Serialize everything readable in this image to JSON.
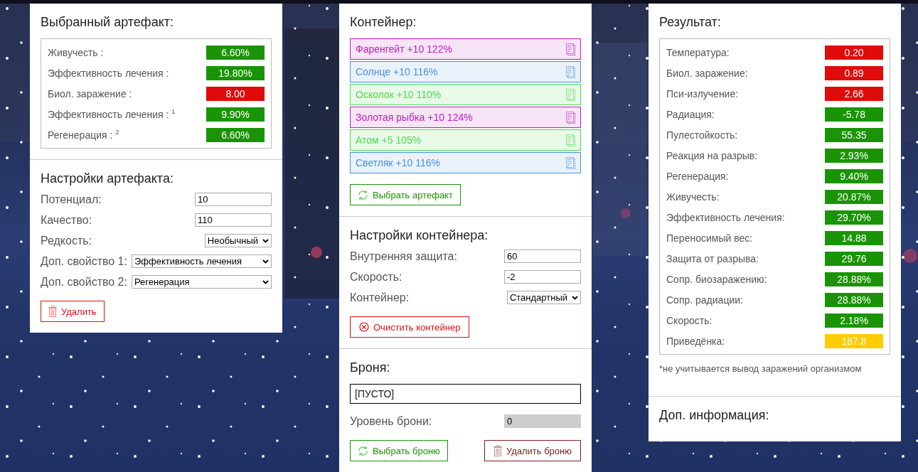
{
  "selected_artifact": {
    "title": "Выбранный артефакт:",
    "stats": [
      {
        "label": "Живучесть :",
        "value": "6.60%",
        "color": "#1a9406"
      },
      {
        "label": "Эффективность лечения :",
        "value": "19.80%",
        "color": "#1a9406"
      },
      {
        "label": "Биол. заражение :",
        "value": "8.00",
        "color": "#e00b0b"
      },
      {
        "label": "Эффективность лечения : $^{1}$",
        "value": "9.90%",
        "color": "#1a9406"
      },
      {
        "label": "Регенерация : $^{2}$",
        "value": "6.60%",
        "color": "#1a9406"
      }
    ]
  },
  "artifact_settings": {
    "title": "Настройки артефакта:",
    "fields": [
      {
        "kind": "input",
        "label": "Потенциал:",
        "value": "10"
      },
      {
        "kind": "input",
        "label": "Качество:",
        "value": "110"
      },
      {
        "kind": "select",
        "label": "Редкость:",
        "value": "Необычный"
      },
      {
        "kind": "wideselect",
        "label": "Доп. свойство 1:",
        "value": "Эффективность лечения"
      },
      {
        "kind": "wideselect",
        "label": "Доп. свойство 2:",
        "value": "Регенерация"
      }
    ],
    "delete_button": "Удалить"
  },
  "container": {
    "title": "Контейнер:",
    "items": [
      {
        "label": "Фаренгейт +10 122%",
        "color": "#c020c0"
      },
      {
        "label": "Солнце +10 116%",
        "color": "#4a90e2"
      },
      {
        "label": "Осколок +10 110%",
        "color": "#4cd94c"
      },
      {
        "label": "Золотая рыбка +10 124%",
        "color": "#c020c0"
      },
      {
        "label": "Атом +5 105%",
        "color": "#4cd94c"
      },
      {
        "label": "Светляк +10 116%",
        "color": "#4a90e2"
      }
    ],
    "select_button": "Выбрать артефакт"
  },
  "container_settings": {
    "title": "Настройки контейнера:",
    "fields": [
      {
        "kind": "input",
        "label": "Внутренняя защита:",
        "value": "60"
      },
      {
        "kind": "input",
        "label": "Скорость:",
        "value": "-2"
      },
      {
        "kind": "select",
        "label": "Контейнер:",
        "value": "Стандартный"
      }
    ],
    "clear_button": "Очистить контейнер"
  },
  "armor": {
    "title": "Броня:",
    "name": "[ПУСТО]",
    "level_label": "Уровень брони:",
    "level_value": "0",
    "level_disabled": true,
    "select_button": "Выбрать броню",
    "delete_button": "Удалить броню"
  },
  "result": {
    "title": "Результат:",
    "stats": [
      {
        "label": "Температура:",
        "value": "0.20",
        "color": "#e00b0b"
      },
      {
        "label": "Биол. заражение:",
        "value": "0.89",
        "color": "#e00b0b"
      },
      {
        "label": "Пси-излучение:",
        "value": "2.66",
        "color": "#e00b0b"
      },
      {
        "label": "Радиация:",
        "value": "-5.78",
        "color": "#1a9406"
      },
      {
        "label": "Пулестойкость:",
        "value": "55.35",
        "color": "#1a9406"
      },
      {
        "label": "Реакция на разрыв:",
        "value": "2.93%",
        "color": "#1a9406"
      },
      {
        "label": "Регенерация:",
        "value": "9.40%",
        "color": "#1a9406"
      },
      {
        "label": "Живучесть:",
        "value": "20.87%",
        "color": "#1a9406"
      },
      {
        "label": "Эффективность лечения:",
        "value": "29.70%",
        "color": "#1a9406"
      },
      {
        "label": "Переносимый вес:",
        "value": "14.88",
        "color": "#1a9406"
      },
      {
        "label": "Защита от разрыва:",
        "value": "29.76",
        "color": "#1a9406"
      },
      {
        "label": "Сопр. биозаражению:",
        "value": "28.88%",
        "color": "#1a9406"
      },
      {
        "label": "Сопр. радиации:",
        "value": "28.88%",
        "color": "#1a9406"
      },
      {
        "label": "Скорость:",
        "value": "2.18%",
        "color": "#1a9406"
      },
      {
        "label": "Приведёнка:",
        "value": "187.8",
        "color": "#ffcc00"
      }
    ],
    "note": "*не учитывается вывод заражений организмом"
  },
  "extra_info": {
    "title": "Доп. информация:"
  }
}
